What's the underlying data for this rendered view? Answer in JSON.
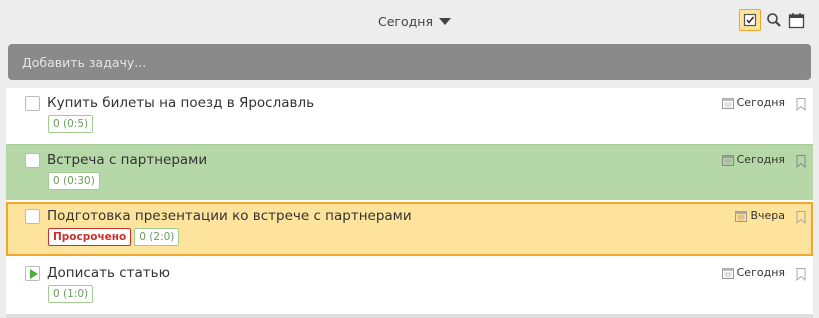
{
  "header": {
    "date_filter_label": "Сегодня"
  },
  "add_task": {
    "placeholder": "Добавить задачу..."
  },
  "tasks": [
    {
      "title": "Купить билеты на поезд в Ярославль",
      "time_badge": "0 (0:5)",
      "due": "Сегодня",
      "state": "todo"
    },
    {
      "title": "Встреча с партнерами",
      "time_badge": "0 (0:30)",
      "due": "Сегодня",
      "state": "todo"
    },
    {
      "title": "Подготовка презентации ко встрече с партнерами",
      "overdue_badge": "Просрочено",
      "time_badge": "0 (2:0)",
      "due": "Вчера",
      "state": "overdue"
    },
    {
      "title": "Дописать статью",
      "time_badge": "0 (1:0)",
      "due": "Сегодня",
      "state": "in-progress"
    }
  ],
  "colors": {
    "accent_orange": "#f0a72e",
    "highlight_yellow": "#fde39b",
    "highlight_green": "#b6d8a8",
    "overdue_red": "#c9302c",
    "badge_green": "#6a9e5c",
    "play_green": "#4caf3a"
  },
  "icons": {
    "header_checklist": "checklist-icon",
    "header_search": "search-icon",
    "header_calendar": "calendar-icon",
    "task_due": "calendar-icon",
    "task_flag": "bookmark-icon",
    "task_start": "play-icon"
  }
}
